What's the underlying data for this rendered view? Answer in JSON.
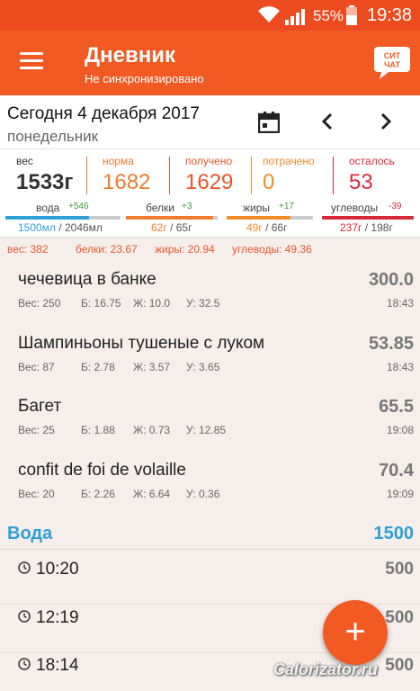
{
  "status": {
    "battery": "55%",
    "time": "19:38"
  },
  "header": {
    "title": "Дневник",
    "subtitle": "Не синхронизировано",
    "chat_logo": "СИТ ЧАТ"
  },
  "date": {
    "title": "Сегодня 4 декабря 2017",
    "weekday": "понедельник"
  },
  "stats": [
    {
      "label": "вес",
      "value": "1533г",
      "color": "#333333"
    },
    {
      "label": "норма",
      "value": "1682",
      "color": "#f07a30"
    },
    {
      "label": "получено",
      "value": "1629",
      "color": "#e8562a"
    },
    {
      "label": "потрачено",
      "value": "0",
      "color": "#f28a2a"
    },
    {
      "label": "осталось",
      "value": "53",
      "color": "#d8283a"
    }
  ],
  "macros": [
    {
      "label": "вода",
      "delta": "+546",
      "delta_color": "#3a9a3a",
      "consumed": "1500мл",
      "norm": "2046мл",
      "color": "#2f9fd8",
      "progress": 0.73
    },
    {
      "label": "белки",
      "delta": "+3",
      "delta_color": "#3a9a3a",
      "consumed": "62г",
      "norm": "65г",
      "color": "#f07a30",
      "progress": 0.95
    },
    {
      "label": "жиры",
      "delta": "+17",
      "delta_color": "#3a9a3a",
      "consumed": "49г",
      "norm": "66г",
      "color": "#f28a2a",
      "progress": 0.74
    },
    {
      "label": "углеводы",
      "delta": "-39",
      "delta_color": "#d8283a",
      "consumed": "237г",
      "norm": "198г",
      "color": "#d8283a",
      "progress": 1.0
    }
  ],
  "totals": {
    "weight": "вес: 382",
    "protein": "белки: 23.67",
    "fat": "жиры: 20.94",
    "carbs": "углеводы: 49.36"
  },
  "foods": [
    {
      "name": "чечевица в банке",
      "kcal": "300.0",
      "weight": "Вес: 250",
      "protein": "Б: 16.75",
      "fat": "Ж: 10.0",
      "carbs": "У: 32.5",
      "time": "18:43"
    },
    {
      "name": "Шампиньоны тушеные с луком",
      "kcal": "53.85",
      "weight": "Вес: 87",
      "protein": "Б: 2.78",
      "fat": "Ж: 3.57",
      "carbs": "У: 3.65",
      "time": "18:43"
    },
    {
      "name": "Багет",
      "kcal": "65.5",
      "weight": "Вес: 25",
      "protein": "Б: 1.88",
      "fat": "Ж: 0.73",
      "carbs": "У: 12.85",
      "time": "19:08"
    },
    {
      "name": "confit de foi de volaille",
      "kcal": "70.4",
      "weight": "Вес: 20",
      "protein": "Б: 2.26",
      "fat": "Ж: 6.64",
      "carbs": "У: 0.36",
      "time": "19:09"
    }
  ],
  "water": {
    "label": "Вода",
    "total": "1500",
    "entries": [
      {
        "time": "10:20",
        "amount": "500"
      },
      {
        "time": "12:19",
        "amount": "500"
      },
      {
        "time": "18:14",
        "amount": "500"
      }
    ]
  },
  "fab": {
    "label": "+"
  },
  "watermark": "Calorizator.ru",
  "colors": {
    "primary": "#f15a22",
    "status_bar": "#ec4a1f",
    "water": "#2f9fd8",
    "background": "#f6eeea"
  }
}
